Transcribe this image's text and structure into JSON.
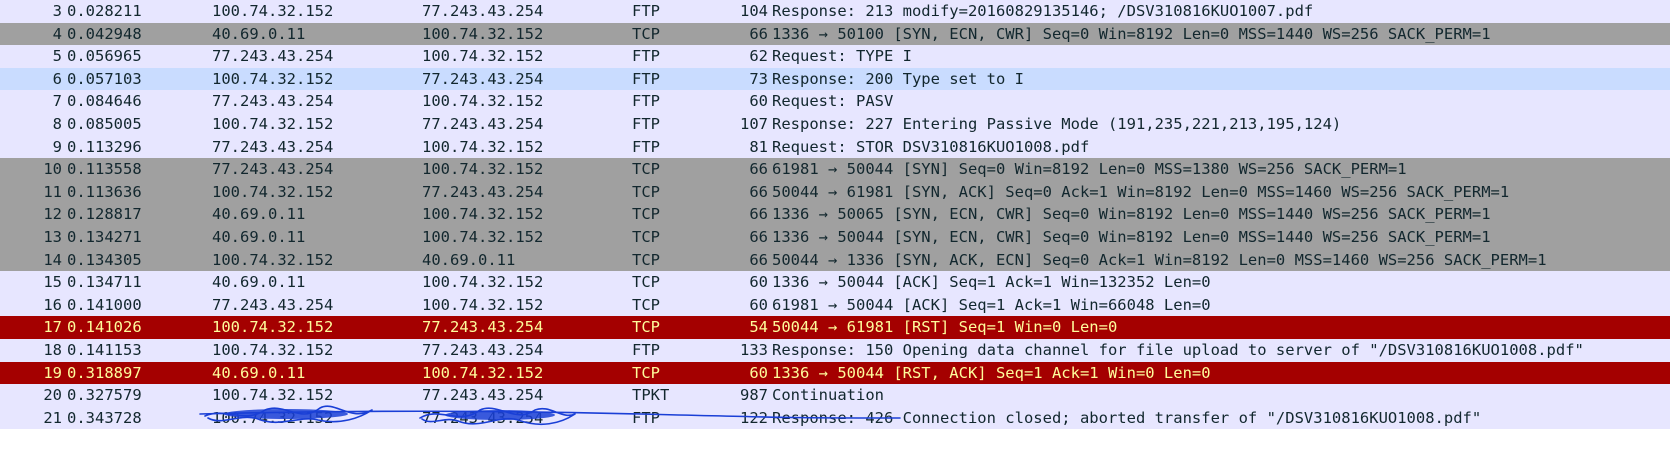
{
  "packet_list": {
    "rows": [
      {
        "no": "3",
        "time": "0.028211",
        "src": "100.74.32.152",
        "dst": "77.243.43.254",
        "proto": "FTP",
        "len": "104",
        "info": "Response: 213 modify=20160829135146; /DSV310816KUO1007.pdf",
        "style": "ftp"
      },
      {
        "no": "4",
        "time": "0.042948",
        "src": "40.69.0.11",
        "dst": "100.74.32.152",
        "proto": "TCP",
        "len": "66",
        "info": "1336 → 50100 [SYN, ECN, CWR] Seq=0 Win=8192 Len=0 MSS=1440 WS=256 SACK_PERM=1",
        "style": "syn"
      },
      {
        "no": "5",
        "time": "0.056965",
        "src": "77.243.43.254",
        "dst": "100.74.32.152",
        "proto": "FTP",
        "len": "62",
        "info": "Request: TYPE I",
        "style": "ftp"
      },
      {
        "no": "6",
        "time": "0.057103",
        "src": "100.74.32.152",
        "dst": "77.243.43.254",
        "proto": "FTP",
        "len": "73",
        "info": "Response: 200 Type set to I",
        "style": "sel-ftp"
      },
      {
        "no": "7",
        "time": "0.084646",
        "src": "77.243.43.254",
        "dst": "100.74.32.152",
        "proto": "FTP",
        "len": "60",
        "info": "Request: PASV",
        "style": "ftp"
      },
      {
        "no": "8",
        "time": "0.085005",
        "src": "100.74.32.152",
        "dst": "77.243.43.254",
        "proto": "FTP",
        "len": "107",
        "info": "Response: 227 Entering Passive Mode (191,235,221,213,195,124)",
        "style": "ftp"
      },
      {
        "no": "9",
        "time": "0.113296",
        "src": "77.243.43.254",
        "dst": "100.74.32.152",
        "proto": "FTP",
        "len": "81",
        "info": "Request: STOR DSV310816KUO1008.pdf",
        "style": "ftp"
      },
      {
        "no": "10",
        "time": "0.113558",
        "src": "77.243.43.254",
        "dst": "100.74.32.152",
        "proto": "TCP",
        "len": "66",
        "info": "61981 → 50044 [SYN] Seq=0 Win=8192 Len=0 MSS=1380 WS=256 SACK_PERM=1",
        "style": "syn"
      },
      {
        "no": "11",
        "time": "0.113636",
        "src": "100.74.32.152",
        "dst": "77.243.43.254",
        "proto": "TCP",
        "len": "66",
        "info": "50044 → 61981 [SYN, ACK] Seq=0 Ack=1 Win=8192 Len=0 MSS=1460 WS=256 SACK_PERM=1",
        "style": "syn"
      },
      {
        "no": "12",
        "time": "0.128817",
        "src": "40.69.0.11",
        "dst": "100.74.32.152",
        "proto": "TCP",
        "len": "66",
        "info": "1336 → 50065 [SYN, ECN, CWR] Seq=0 Win=8192 Len=0 MSS=1440 WS=256 SACK_PERM=1",
        "style": "syn"
      },
      {
        "no": "13",
        "time": "0.134271",
        "src": "40.69.0.11",
        "dst": "100.74.32.152",
        "proto": "TCP",
        "len": "66",
        "info": "1336 → 50044 [SYN, ECN, CWR] Seq=0 Win=8192 Len=0 MSS=1440 WS=256 SACK_PERM=1",
        "style": "syn"
      },
      {
        "no": "14",
        "time": "0.134305",
        "src": "100.74.32.152",
        "dst": "40.69.0.11",
        "proto": "TCP",
        "len": "66",
        "info": "50044 → 1336 [SYN, ACK, ECN] Seq=0 Ack=1 Win=8192 Len=0 MSS=1460 WS=256 SACK_PERM=1",
        "style": "syn"
      },
      {
        "no": "15",
        "time": "0.134711",
        "src": "40.69.0.11",
        "dst": "100.74.32.152",
        "proto": "TCP",
        "len": "60",
        "info": "1336 → 50044 [ACK] Seq=1 Ack=1 Win=132352 Len=0",
        "style": "tcp"
      },
      {
        "no": "16",
        "time": "0.141000",
        "src": "77.243.43.254",
        "dst": "100.74.32.152",
        "proto": "TCP",
        "len": "60",
        "info": "61981 → 50044 [ACK] Seq=1 Ack=1 Win=66048 Len=0",
        "style": "tcp"
      },
      {
        "no": "17",
        "time": "0.141026",
        "src": "100.74.32.152",
        "dst": "77.243.43.254",
        "proto": "TCP",
        "len": "54",
        "info": "50044 → 61981 [RST] Seq=1 Win=0 Len=0",
        "style": "rst"
      },
      {
        "no": "18",
        "time": "0.141153",
        "src": "100.74.32.152",
        "dst": "77.243.43.254",
        "proto": "FTP",
        "len": "133",
        "info": "Response: 150 Opening data channel for file upload to server of \"/DSV310816KUO1008.pdf\"",
        "style": "ftp"
      },
      {
        "no": "19",
        "time": "0.318897",
        "src": "40.69.0.11",
        "dst": "100.74.32.152",
        "proto": "TCP",
        "len": "60",
        "info": "1336 → 50044 [RST, ACK] Seq=1 Ack=1 Win=0 Len=0",
        "style": "rst"
      },
      {
        "no": "20",
        "time": "0.327579",
        "src": "100.74.32.152",
        "dst": "77.243.43.254",
        "proto": "TPKT",
        "len": "987",
        "info": "Continuation",
        "style": "tpkt"
      },
      {
        "no": "21",
        "time": "0.343728",
        "src": "100.74.32.152",
        "dst": "77.243.43.254",
        "proto": "FTP",
        "len": "122",
        "info": "Response: 426 Connection closed; aborted transfer of \"/DSV310816KUO1008.pdf\"",
        "style": "ftp"
      }
    ]
  },
  "colors": {
    "ftp_bg": "#e7e6ff",
    "selected_bg": "#c9dcff",
    "syn_bg": "#a0a0a0",
    "rst_bg": "#a40000",
    "rst_fg": "#fffc9c",
    "text": "#12272e",
    "scribble": "#1a3fd6"
  }
}
